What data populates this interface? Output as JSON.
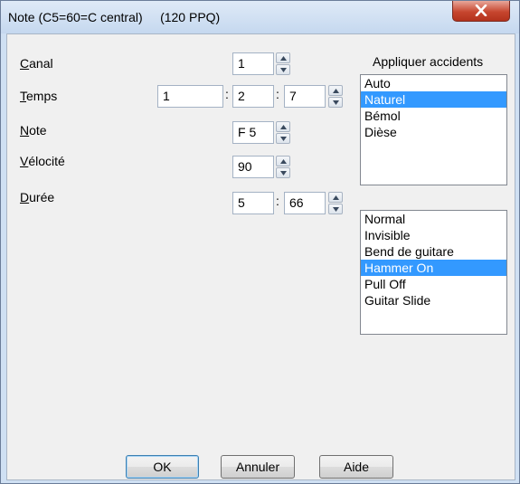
{
  "window": {
    "title": "Note (C5=60=C central)     (120 PPQ)",
    "close_icon": "close-x-icon"
  },
  "fields": {
    "canal": {
      "label": "Canal",
      "mnemonic": "C",
      "label_rest": "anal",
      "value": "1"
    },
    "temps": {
      "label": "Temps",
      "mnemonic": "T",
      "label_rest": "emps",
      "values": [
        "1",
        "2",
        "7"
      ],
      "separator": ":"
    },
    "note": {
      "label": "Note",
      "mnemonic": "N",
      "label_rest": "ote",
      "value": "F 5"
    },
    "velocite": {
      "label": "Vélocité",
      "mnemonic": "V",
      "label_rest": "élocité",
      "value": "90"
    },
    "duree": {
      "label": "Durée",
      "mnemonic": "D",
      "label_rest": "urée",
      "values": [
        "5",
        "66"
      ],
      "separator": ":"
    }
  },
  "accidents": {
    "heading": "Appliquer accidents",
    "items": [
      "Auto",
      "Naturel",
      "Bémol",
      "Dièse"
    ],
    "selected": "Naturel"
  },
  "style_list": {
    "items": [
      "Normal",
      "Invisible",
      "Bend de guitare",
      "Hammer On",
      "Pull Off",
      "Guitar Slide"
    ],
    "selected": "Hammer On"
  },
  "buttons": {
    "ok": "OK",
    "cancel": "Annuler",
    "help": "Aide"
  },
  "colors": {
    "selection": "#3399ff",
    "close_button": "#c7462f"
  }
}
